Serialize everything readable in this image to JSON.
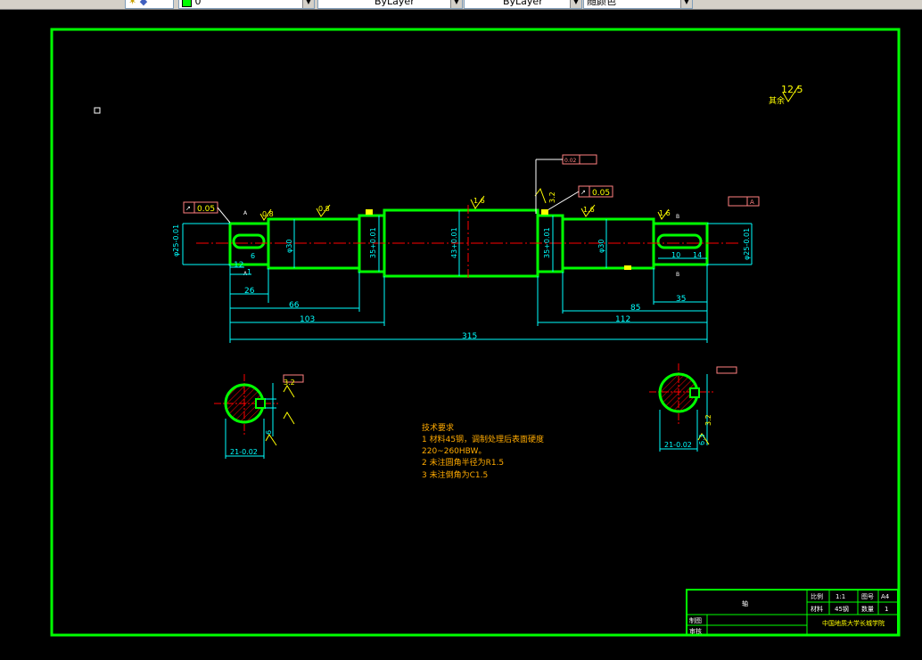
{
  "toolbar": {
    "layer_value": "0",
    "color_value": "ByLayer",
    "linetype_value": "ByLayer",
    "lineweight_value": "随颜色"
  },
  "colors": {
    "frame": "#00ff00",
    "part": "#00ff00",
    "dim": "#00ffff",
    "center": "#ff0000",
    "note": "#ffaa00",
    "symbol": "#ffff00",
    "white": "#ffffff"
  },
  "drawing": {
    "roughness_all": "12.5",
    "roughness_all_label": "其余",
    "roughness": {
      "r1": "0.8",
      "r2": "0.8",
      "r3": "1.6",
      "r4": "1.6",
      "r5": "1.6",
      "r6": "3.2"
    },
    "tolerances": {
      "left_runout": "0.05",
      "right_runout": "0.05",
      "top_frame": "0.02",
      "right_datum": "A"
    },
    "diameters": {
      "d_left_end": "φ25-0.01",
      "d_30_left": "φ30",
      "d_35_left": "35+0.01",
      "d_43": "43+0.01",
      "d_35_right": "35+0.01",
      "d_30_right": "φ30",
      "d_right_end": "φ25-0.01"
    },
    "lengths": {
      "l12": "12",
      "l1": "1",
      "l6": "6",
      "l26": "26",
      "l66": "66",
      "l103": "103",
      "l315": "315",
      "l112": "112",
      "l85": "85",
      "l35": "35",
      "l10": "10",
      "l14": "14"
    },
    "sections": {
      "left_width": "21-0.02",
      "left_keyway": "6",
      "left_r": "3.2",
      "right_width": "21-0.02",
      "right_keyway": "6.3",
      "right_r": "3.2"
    },
    "notes": {
      "title": "技术要求",
      "line1": "1 材料45钢，调制处理后表面硬度",
      "line2": "220~260HBW。",
      "line3": "2 未注圆角半径为R1.5",
      "line4": "3 未注倒角为C1.5"
    },
    "title_block": {
      "part_name": "轴",
      "scale_label": "比例",
      "scale": "1:1",
      "sheet_label": "图号",
      "sheet": "A4",
      "material_label": "材料",
      "material": "45钢",
      "qty_label": "数量",
      "qty": "1",
      "drawn_label": "制图",
      "checked_label": "审核",
      "school": "中国地质大学长城学院"
    }
  }
}
